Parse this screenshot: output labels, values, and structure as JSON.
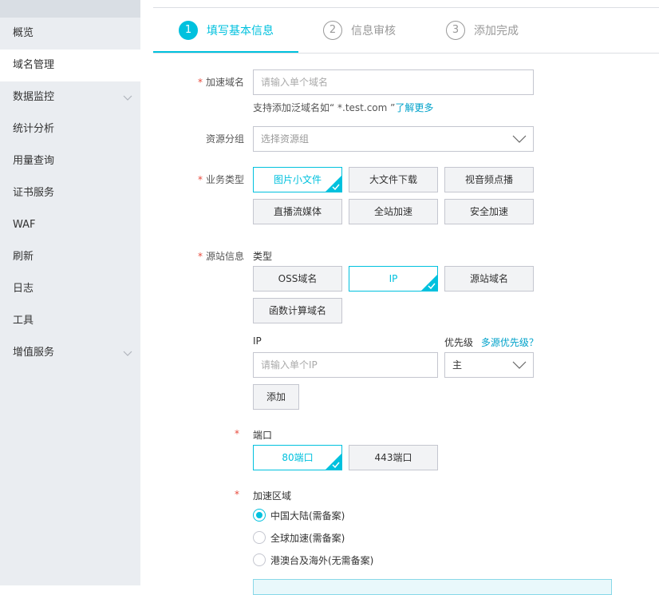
{
  "sidebar": {
    "items": [
      {
        "label": "概览"
      },
      {
        "label": "域名管理"
      },
      {
        "label": "数据监控"
      },
      {
        "label": "统计分析"
      },
      {
        "label": "用量查询"
      },
      {
        "label": "证书服务"
      },
      {
        "label": "WAF"
      },
      {
        "label": "刷新"
      },
      {
        "label": "日志"
      },
      {
        "label": "工具"
      },
      {
        "label": "增值服务"
      }
    ]
  },
  "steps": [
    {
      "num": "1",
      "label": "填写基本信息"
    },
    {
      "num": "2",
      "label": "信息审核"
    },
    {
      "num": "3",
      "label": "添加完成"
    }
  ],
  "form": {
    "required_mark": "*",
    "domain": {
      "label": "加速域名",
      "placeholder": "请输入单个域名",
      "hint_prefix": "支持添加泛域名如“ *.test.com ”",
      "hint_link": "了解更多"
    },
    "resource_group": {
      "label": "资源分组",
      "placeholder": "选择资源组"
    },
    "business_type": {
      "label": "业务类型",
      "options": [
        "图片小文件",
        "大文件下载",
        "视音频点播",
        "直播流媒体",
        "全站加速",
        "安全加速"
      ],
      "selected": "图片小文件"
    },
    "origin": {
      "label": "源站信息",
      "type_label": "类型",
      "types": [
        "OSS域名",
        "IP",
        "源站域名",
        "函数计算域名"
      ],
      "selected": "IP",
      "ip_label": "IP",
      "ip_placeholder": "请输入单个IP",
      "priority_label": "优先级",
      "priority_link": "多源优先级？",
      "priority_value": "主",
      "add_button": "添加"
    },
    "port": {
      "label": "端口",
      "options": [
        "80端口",
        "443端口"
      ],
      "selected": "80端口"
    },
    "region": {
      "label": "加速区域",
      "options": [
        "中国大陆(需备案)",
        "全球加速(需备案)",
        "港澳台及海外(无需备案)"
      ],
      "selected": "中国大陆(需备案)"
    }
  },
  "colors": {
    "accent": "#00c1de",
    "required": "#e84a3c",
    "link": "#00a2ca",
    "sidebar_bg": "#eaedf1"
  }
}
